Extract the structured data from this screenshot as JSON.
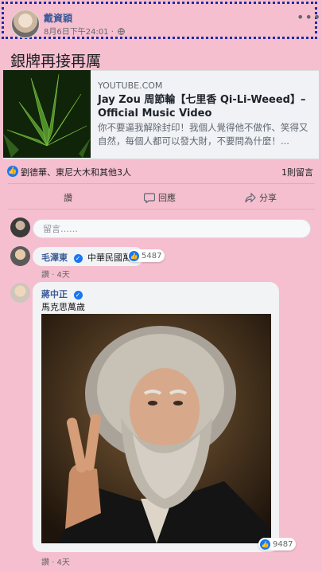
{
  "post": {
    "author": "戴資穎",
    "time": "8月6日下午24:01 ·",
    "text": "銀牌再接再厲"
  },
  "link_card": {
    "domain": "YOUTUBE.COM",
    "title": "Jay Zou 周節輪【七里香 Qi-Li-Weeed】– Official Music Video",
    "description": "你不要逼我解除封印！我個人覺得他不做作、笑得又自然，每個人都可以發大財，不要問為什麼！..."
  },
  "reactions": {
    "summary": "劉德華、東尼大木和其他3人",
    "comments": "1則留言"
  },
  "actions": {
    "like": "讚",
    "comment": "回應",
    "share": "分享"
  },
  "comment_box": {
    "placeholder": "留言……"
  },
  "comments": [
    {
      "name": "毛澤東",
      "text": "中華民國萬",
      "likes": "5487",
      "meta_like": "讚",
      "meta_time": "· 4天"
    },
    {
      "name": "蔣中正",
      "text": "馬克思萬歲",
      "likes": "9487",
      "meta_like": "讚",
      "meta_time": "· 4天"
    }
  ],
  "colors": {
    "background": "#f5bfcf",
    "link": "#3b5998",
    "facebook_blue": "#1877f2"
  }
}
